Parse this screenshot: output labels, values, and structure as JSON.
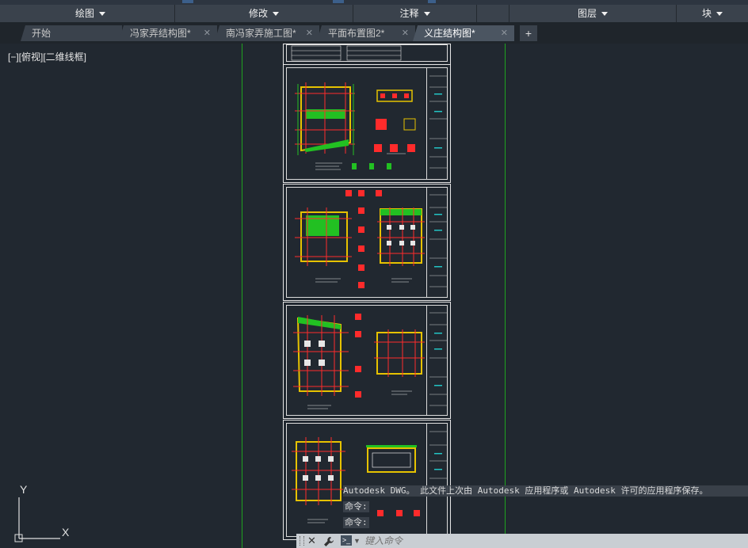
{
  "ribbon": {
    "panels": [
      {
        "label": "绘图",
        "has_dropdown": true
      },
      {
        "label": "修改",
        "has_dropdown": true
      },
      {
        "label": "注释",
        "has_dropdown": true
      },
      {
        "label": "",
        "has_dropdown": false
      },
      {
        "label": "图层",
        "has_dropdown": true
      },
      {
        "label": "块",
        "has_dropdown": true
      }
    ]
  },
  "tabs": [
    {
      "label": "开始",
      "closable": false,
      "active": false
    },
    {
      "label": "冯家弄结构图*",
      "closable": true,
      "active": false
    },
    {
      "label": "南冯家弄施工图*",
      "closable": true,
      "active": false
    },
    {
      "label": "平面布置图2*",
      "closable": true,
      "active": false
    },
    {
      "label": "义庄结构图*",
      "closable": true,
      "active": true
    }
  ],
  "new_tab_icon": "plus-icon",
  "close_tab_icon": "close-icon",
  "viewport": {
    "label": "[−][俯视][二维线框]"
  },
  "ucs": {
    "x_label": "X",
    "y_label": "Y"
  },
  "command": {
    "history": "Autodesk DWG。 此文件上次由 Autodesk 应用程序或 Autodesk 许可的应用程序保存。",
    "lines": [
      "命令:",
      "命令:"
    ],
    "placeholder": "键入命令"
  },
  "colors": {
    "background": "#212830",
    "guide_lines": "#1fa31f",
    "sheet_border": "#e6e6e6",
    "ribbon": "#3a424c",
    "active_tab": "#4b5561"
  }
}
